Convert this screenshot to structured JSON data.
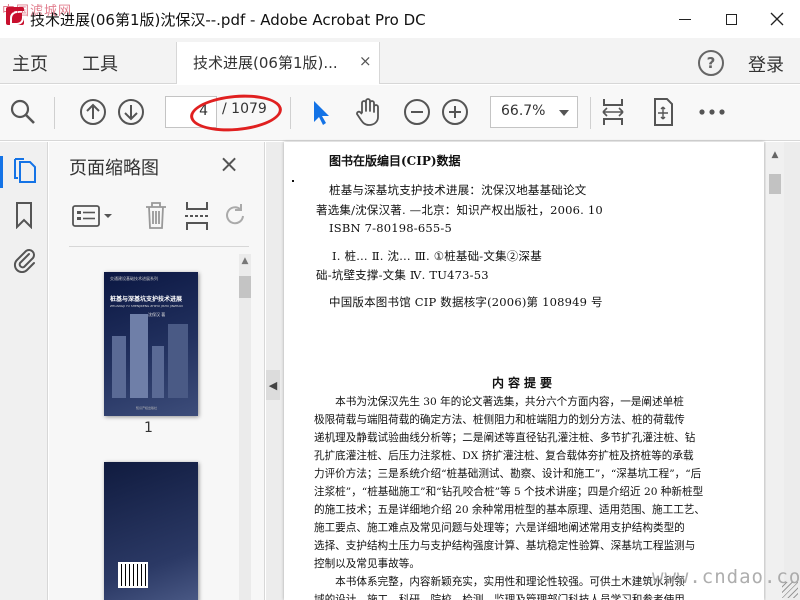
{
  "window": {
    "title": "技术进展(06第1版)沈保汉--.pdf - Adobe Acrobat Pro DC",
    "watermark_top": "中国滤城网",
    "watermark_bottom": "www.cndao.com"
  },
  "menu": {
    "home": "主页",
    "tools": "工具",
    "tab_label": "技术进展(06第1版)...",
    "tab_close": "×",
    "help": "?",
    "login": "登录"
  },
  "toolbar": {
    "current_page": "4",
    "total_pages": "/ 1079",
    "zoom": "66.7%"
  },
  "thumbnails": {
    "title": "页面缩略图",
    "close": "×",
    "page1_label": "1",
    "cover_series": "交通建设基础技术进展系列",
    "cover_title": "桩基与深基坑支护技术进展",
    "cover_subtitle": "ZHUANGJI YU SHENJIKENG ZHIHU JISHU JINZHAN",
    "cover_author": "沈保汉 著",
    "cover_publisher": "知识产权出版社"
  },
  "document": {
    "cip_heading": "图书在版编目(CIP)数据",
    "cip_lines": [
      "桩基与深基坑支护技术进展：沈保汉地基基础论文",
      "著选集/沈保汉著. —北京：知识产权出版社，2006. 10",
      "ISBN 7-80198-655-5",
      "Ⅰ. 桩…  Ⅱ. 沈…  Ⅲ. ①桩基础-文集②深基",
      "础-坑壁支撑-文集  Ⅳ. TU473-53",
      "中国版本图书馆 CIP 数据核字(2006)第 108949 号"
    ],
    "abstract_heading": "内容提要",
    "abstract_lines": [
      "　　本书为沈保汉先生 30 年的论文著选集，共分六个方面内容，一是阐述单桩",
      "极限荷载与端阻荷载的确定方法、桩侧阻力和桩端阻力的划分方法、桩的荷载传",
      "递机理及静载试验曲线分析等；二是阐述等直径钻孔灌注桩、多节扩孔灌注桩、钻",
      "孔扩底灌注桩、后压力注浆桩、DX 挤扩灌注桩、复合载体夯扩桩及挤桩等的承载",
      "力评价方法；三是系统介绍“桩基础测试、勘察、设计和施工”，“深基坑工程”，“后",
      "注浆桩”，“桩基础施工”和“钻孔咬合桩”等 5 个技术讲座；四是介绍近 20 种新桩型",
      "的施工技术；五是详细地介绍 20 余种常用桩型的基本原理、适用范围、施工工艺、",
      "施工要点、施工难点及常见问题与处理等；六是详细地阐述常用支护结构类型的",
      "选择、支护结构土压力与支护结构强度计算、基坑稳定性验算、深基坑工程监测与",
      "控制以及常见事故等。",
      "　　本书体系完整，内容新颖充实，实用性和理论性较强。可供土木建筑水利领",
      "域的设计、施工、科研、院校、检测、监理及管理部门科技人员学习和参考使用。"
    ]
  },
  "colors": {
    "accent_blue": "#1473e6",
    "annotation_red": "#e02020"
  }
}
